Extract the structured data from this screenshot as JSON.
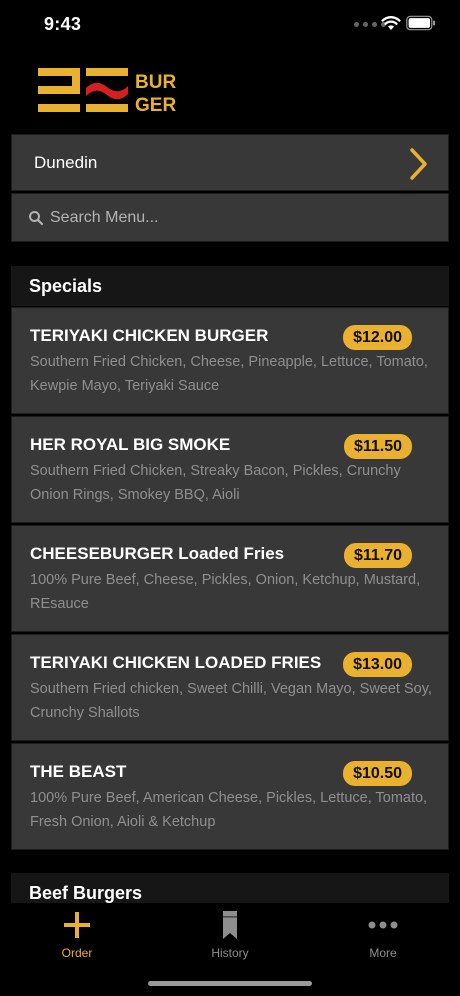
{
  "status_bar": {
    "time": "9:43"
  },
  "location": {
    "name": "Dunedin"
  },
  "search": {
    "placeholder": "Search Menu..."
  },
  "sections": [
    {
      "title": "Specials",
      "items": [
        {
          "name": "TERIYAKI CHICKEN BURGER",
          "price": "$12.00",
          "description": "Southern Fried Chicken, Cheese, Pineapple, Lettuce, Tomato, Kewpie Mayo, Teriyaki Sauce"
        },
        {
          "name": "HER ROYAL BIG SMOKE",
          "price": "$11.50",
          "description": "Southern Fried Chicken, Streaky Bacon, Pickles, Crunchy Onion Rings, Smokey BBQ, Aioli"
        },
        {
          "name": "CHEESEBURGER Loaded Fries",
          "price": "$11.70",
          "description": "100% Pure Beef, Cheese, Pickles, Onion, Ketchup, Mustard, REsauce"
        },
        {
          "name": "TERIYAKI CHICKEN LOADED FRIES",
          "price": "$13.00",
          "description": "Southern Fried chicken, Sweet Chilli, Vegan Mayo, Sweet Soy, Crunchy Shallots"
        },
        {
          "name": "THE BEAST",
          "price": "$10.50",
          "description": "100% Pure Beef, American Cheese, Pickles, Lettuce, Tomato, Fresh Onion, Aioli & Ketchup"
        }
      ]
    },
    {
      "title": "Beef Burgers",
      "items": []
    }
  ],
  "tabs": [
    {
      "label": "Order",
      "icon": "plus-icon",
      "active": true
    },
    {
      "label": "History",
      "icon": "bookmark-icon",
      "active": false
    },
    {
      "label": "More",
      "icon": "more-dots-icon",
      "active": false
    }
  ],
  "colors": {
    "accent": "#e9b12f",
    "logo_red": "#d42020",
    "card_bg": "#383838"
  }
}
